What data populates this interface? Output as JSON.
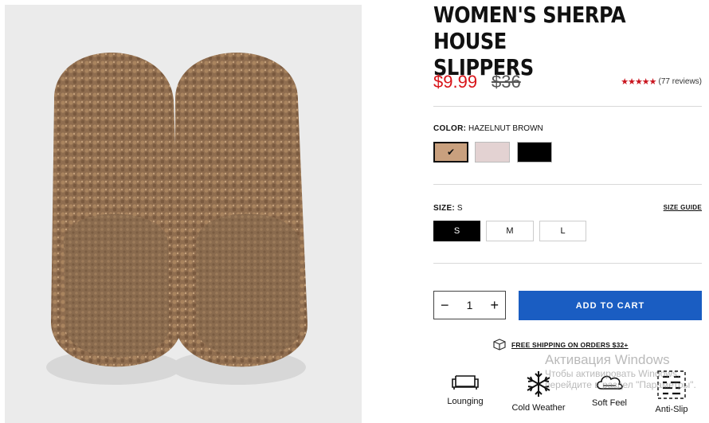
{
  "product": {
    "title": "WOMEN'S SHERPA HOUSE\nSLIPPERS",
    "price_sale": "$9.99",
    "price_original": "$36",
    "rating_stars": "★★★★★",
    "rating_count": "(77 reviews)"
  },
  "color": {
    "label": "COLOR:",
    "value": "HAZELNUT BROWN",
    "selected_mark": "✔",
    "swatches": [
      {
        "name": "hazelnut-brown",
        "hex": "#c9a07e"
      },
      {
        "name": "blush",
        "hex": "#e3d2d2"
      },
      {
        "name": "black",
        "hex": "#000000"
      }
    ]
  },
  "size": {
    "label": "SIZE:",
    "value": "S",
    "guide_label": "SIZE GUIDE",
    "options": [
      "S",
      "M",
      "L"
    ]
  },
  "quantity": {
    "minus": "−",
    "value": "1",
    "plus": "+"
  },
  "cart": {
    "label": "ADD TO CART"
  },
  "shipping": {
    "label": "FREE SHIPPING ON ORDERS $32+",
    "icon": "box-icon"
  },
  "features": [
    {
      "label": "Lounging",
      "icon": "sofa-icon"
    },
    {
      "label": "Cold Weather",
      "icon": "snowflake-icon"
    },
    {
      "label": "Soft Feel",
      "icon": "cloud-icon"
    },
    {
      "label": "Anti-Slip",
      "icon": "grip-icon"
    }
  ],
  "watermark": {
    "line1": "Активация Windows",
    "line2": "Чтобы активировать Windows,",
    "line3": "перейдите в раздел \"Параметры\"."
  },
  "colors": {
    "accent_price": "#d8151a",
    "cart_button": "#1a5dc2"
  }
}
